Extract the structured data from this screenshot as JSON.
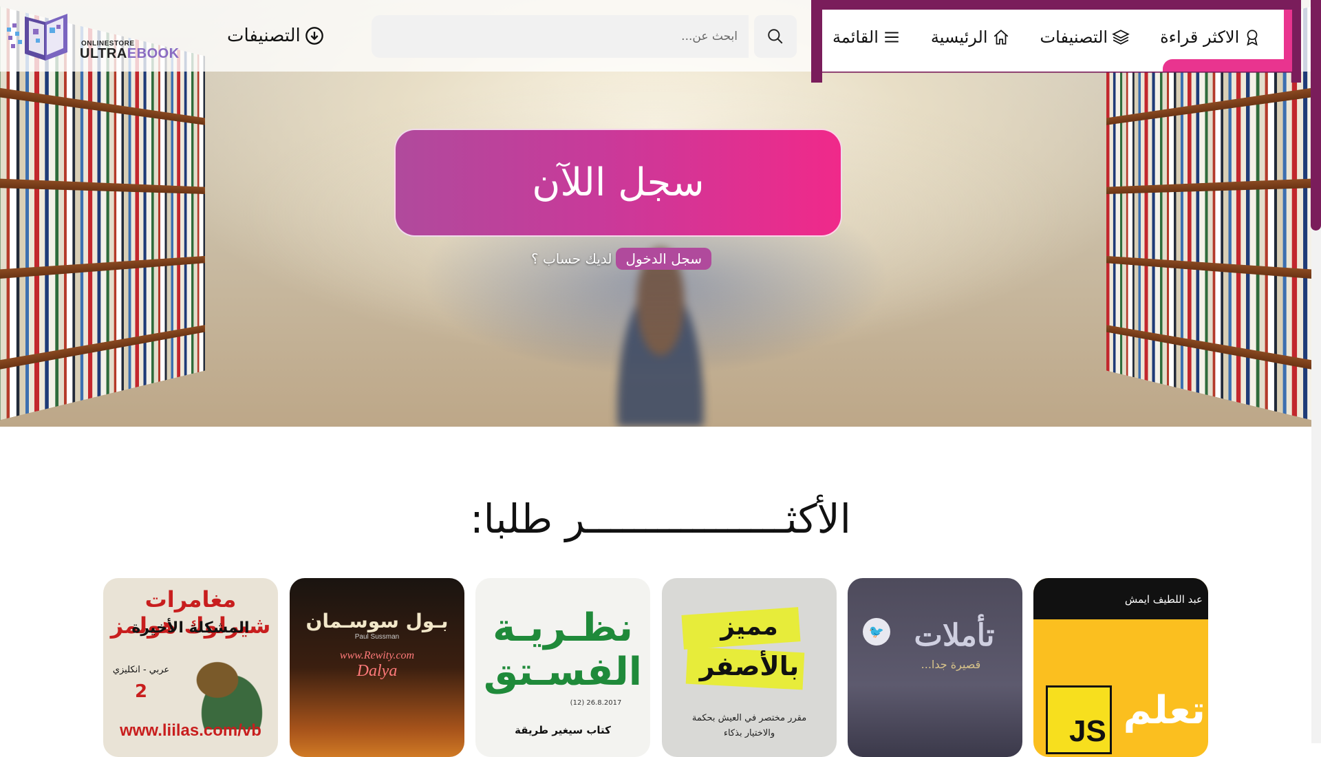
{
  "logo": {
    "small": "ONLINESTORE",
    "brand_part1": "ULTRA",
    "brand_part2": "EBOOK"
  },
  "header": {
    "categories_link": "التصنيفات",
    "search_placeholder": "ابحث عن..."
  },
  "nav": {
    "items": [
      {
        "label": "القائمة",
        "icon": "menu-icon"
      },
      {
        "label": "الرئيسية",
        "icon": "home-icon"
      },
      {
        "label": "التصنيفات",
        "icon": "layers-icon"
      },
      {
        "label": "الاكثر قراءة",
        "icon": "award-icon"
      }
    ]
  },
  "hero": {
    "cta": "سجل اللآن",
    "have_account": "لديك حساب ؟",
    "login": "سجل الدخول"
  },
  "section": {
    "title": "الأكثـــــــــــــــــر طلبا:"
  },
  "books": [
    {
      "line1": "مغامرات شيرلوك هولمز",
      "line2": "المشكلة الأخيرة",
      "line3": "عربي - انكليزي",
      "line4": "2",
      "line5": "www.liilas.com/vb"
    },
    {
      "line1": "بـول سوسـمان",
      "line2": "Paul Sussman",
      "line3": "www.Rewity.com",
      "line4": "Dalya"
    },
    {
      "line1": "نظـريـة",
      "line2": "الفسـتق",
      "line3": "26.8.2017 (12)",
      "line4": "كتاب سيغير طريقة"
    },
    {
      "line1": "مميز",
      "line2": "بالأصفر",
      "line3": "مقرر مختصر في العيش بحكمة",
      "line4": "والاختيار بذكاء"
    },
    {
      "line1": "تأملات",
      "line2": "قصيرة جدا..."
    },
    {
      "line1": "عبد اللطيف ايمش",
      "line2": "تعلم",
      "line3": "JS"
    }
  ],
  "colors": {
    "accent": "#e9348f",
    "dark_accent": "#7a1d5b",
    "purple": "#b04a9c"
  }
}
